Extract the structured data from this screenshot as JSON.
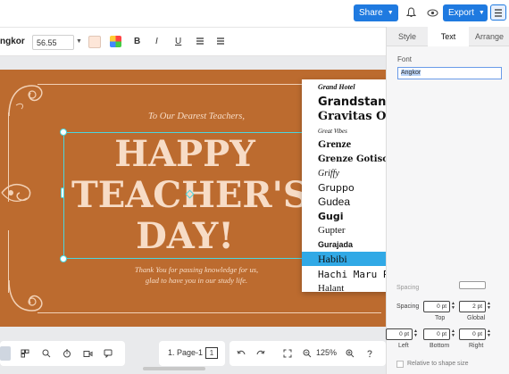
{
  "topbar": {
    "share_label": "Share",
    "export_label": "Export"
  },
  "toolbar": {
    "font_name": "ngkor",
    "font_size": "56.55",
    "bold_label": "B",
    "italic_label": "I",
    "underline_label": "U",
    "swatch_color": "#fde6d8"
  },
  "card": {
    "subtitle": "To Our Dearest Teachers,",
    "headline_line1": "HAPPY",
    "headline_line2": "TEACHER'S",
    "headline_line3": "DAY!",
    "message_line1": "Thank You for passing knowledge for us,",
    "message_line2": "glad to have you in our study life.",
    "background_color": "#bc6b2f",
    "text_color": "#f7dcc6"
  },
  "sidepanel": {
    "tabs": [
      "Style",
      "Text",
      "Arrange"
    ],
    "active_tab": "Text",
    "font_label": "Font",
    "font_value": "Angkor",
    "spacing_label": "Spacing",
    "spacing_top_value": "0 pt",
    "spacing_global_value": "2 pt",
    "top_label": "Top",
    "global_label": "Global",
    "left_value": "0 pt",
    "bottom_value": "0 pt",
    "right_value": "0 pt",
    "left_label": "Left",
    "bottom_label": "Bottom",
    "right_label": "Right",
    "relative_label": "Relative to shape size",
    "partial_label": "Spacing"
  },
  "font_dropdown": {
    "items": [
      {
        "label": "Grand Hotel",
        "font": "'Liberation Serif', serif",
        "style": "italic",
        "weight": "bold",
        "size": "8px"
      },
      {
        "label": "Grandstander",
        "font": "'DejaVu Sans', sans-serif",
        "style": "normal",
        "weight": "bold",
        "size": "13px"
      },
      {
        "label": "Gravitas One",
        "font": "'DejaVu Serif', serif",
        "style": "normal",
        "weight": "bold",
        "size": "13px"
      },
      {
        "label": "Great Vibes",
        "font": "'Liberation Serif', serif",
        "style": "italic",
        "weight": "normal",
        "size": "7px"
      },
      {
        "label": "Grenze",
        "font": "'Liberation Serif', serif",
        "style": "normal",
        "weight": "bold",
        "size": "12px"
      },
      {
        "label": "Grenze Gotisch",
        "font": "'DejaVu Serif', serif",
        "style": "normal",
        "weight": "bold",
        "size": "10px"
      },
      {
        "label": "Griffy",
        "font": "'Liberation Serif', serif",
        "style": "italic",
        "weight": "normal",
        "size": "10px"
      },
      {
        "label": "Gruppo",
        "font": "'DejaVu Sans', sans-serif",
        "style": "normal",
        "weight": "normal",
        "size": "11px"
      },
      {
        "label": "Gudea",
        "font": "'Liberation Sans', sans-serif",
        "style": "normal",
        "weight": "normal",
        "size": "12px"
      },
      {
        "label": "Gugi",
        "font": "'DejaVu Sans', sans-serif",
        "style": "normal",
        "weight": "bold",
        "size": "11px"
      },
      {
        "label": "Gupter",
        "font": "'Liberation Serif', serif",
        "style": "normal",
        "weight": "normal",
        "size": "11px"
      },
      {
        "label": "Gurajada",
        "font": "'Liberation Sans', sans-serif",
        "style": "normal",
        "weight": "bold",
        "size": "9px"
      },
      {
        "label": "Habibi",
        "font": "'Liberation Serif', serif",
        "style": "normal",
        "weight": "normal",
        "size": "12px"
      },
      {
        "label": "Hachi Maru Pop",
        "font": "'DejaVu Sans Mono', monospace",
        "style": "normal",
        "weight": "normal",
        "size": "11px"
      },
      {
        "label": "Halant",
        "font": "'Liberation Serif', serif",
        "style": "normal",
        "weight": "normal",
        "size": "11px"
      }
    ],
    "selected_index": 12
  },
  "statusbar": {
    "page_label": "1. Page-1",
    "zoom_label": "125%"
  }
}
